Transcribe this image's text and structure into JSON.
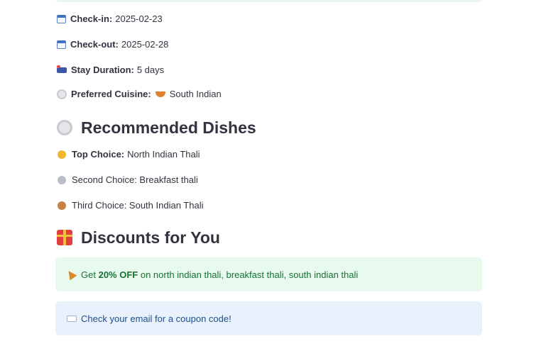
{
  "stay": {
    "checkin_label": "Check-in:",
    "checkin_value": "2025-02-23",
    "checkout_label": "Check-out:",
    "checkout_value": "2025-02-28",
    "duration_label": "Stay Duration:",
    "duration_value": "5 days",
    "cuisine_label": "Preferred Cuisine:",
    "cuisine_value": "South Indian"
  },
  "recommended": {
    "heading": "Recommended Dishes",
    "top_label": "Top Choice:",
    "top_value": "North Indian Thali",
    "second_text": "Second Choice: Breakfast thali",
    "third_text": "Third Choice: South Indian Thali"
  },
  "discounts": {
    "heading": "Discounts for You",
    "offer_prefix": "Get",
    "offer_bold": "20% OFF",
    "offer_suffix": "on north indian thali, breakfast thali, south indian thali",
    "coupon_text": "Check your email for a coupon code!"
  },
  "colors": {
    "success_bg": "#e8f9ee",
    "success_text": "#177233",
    "info_bg": "#e8f1fc",
    "info_text": "#1f4e8c"
  },
  "icons": {
    "checkin": "calendar-icon",
    "checkout": "calendar-icon",
    "duration": "bed-icon",
    "cuisine": "plate-icon",
    "cuisine_value": "curry-icon",
    "recommended_heading": "plate-icon",
    "top_choice": "gold-medal-icon",
    "second_choice": "silver-medal-icon",
    "third_choice": "bronze-medal-icon",
    "discounts_heading": "gift-icon",
    "offer": "party-popper-icon",
    "coupon": "ticket-icon"
  }
}
